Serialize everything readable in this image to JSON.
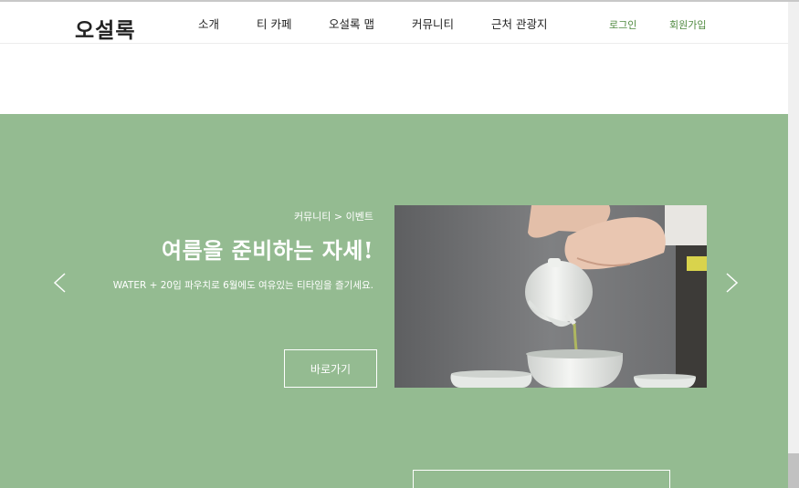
{
  "header": {
    "logo": "오설록",
    "nav": [
      "소개",
      "티 카페",
      "오설록 맵",
      "커뮤니티",
      "근처 관광지"
    ],
    "login": "로그인",
    "signup": "회원가입"
  },
  "hero": {
    "breadcrumb": "커뮤니티 > 이벤트",
    "title": "여름을 준비하는 자세!",
    "description": "WATER + 20입 파우치로 6월에도 여유있는 티타임을 즐기세요.",
    "button_label": "바로가기",
    "background_color": "#94bb91",
    "prev_icon": "chevron-left-icon",
    "next_icon": "chevron-right-icon"
  },
  "colors": {
    "accent": "#4f8a3f",
    "hero_bg": "#94bb91"
  }
}
